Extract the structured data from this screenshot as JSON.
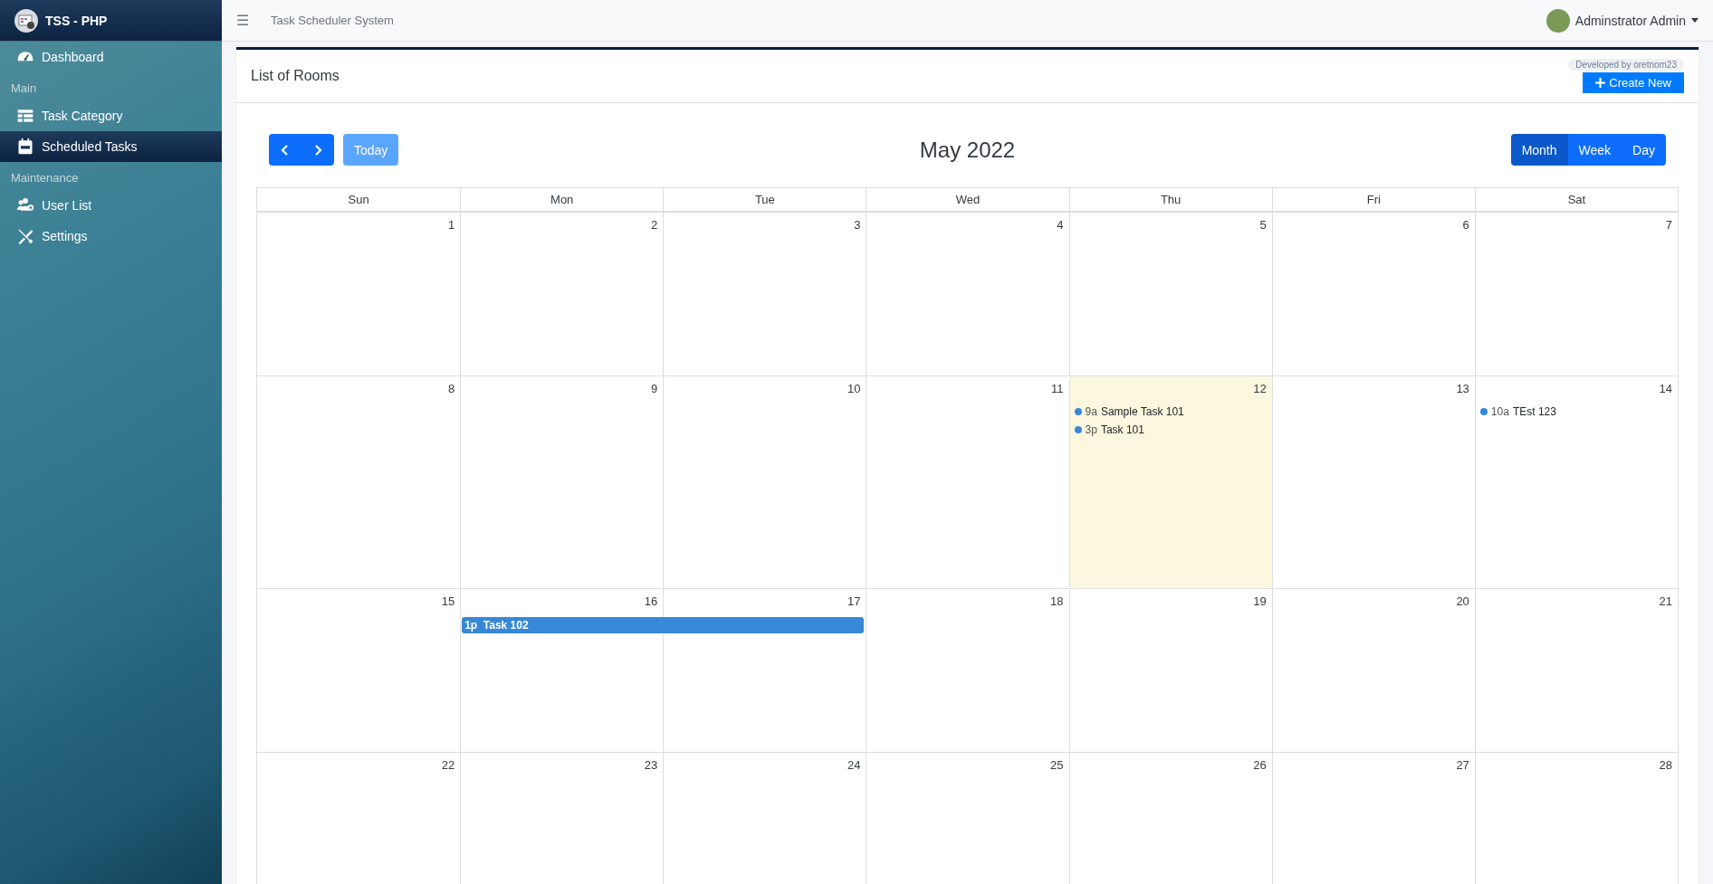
{
  "brand": {
    "title": "TSS - PHP"
  },
  "sidebar": {
    "items": [
      {
        "kind": "link",
        "label": "Dashboard",
        "selected": false
      },
      {
        "kind": "header",
        "label": "Main"
      },
      {
        "kind": "link",
        "label": "Task Category",
        "selected": false
      },
      {
        "kind": "link",
        "label": "Scheduled Tasks",
        "selected": true
      },
      {
        "kind": "header",
        "label": "Maintenance"
      },
      {
        "kind": "link",
        "label": "User List",
        "selected": false
      },
      {
        "kind": "link",
        "label": "Settings",
        "selected": false
      }
    ]
  },
  "topbar": {
    "menu_glyph": "☰",
    "title": "Task Scheduler System",
    "user": "Adminstrator Admin"
  },
  "card": {
    "title": "List of Rooms",
    "credit": "Developed by oretnom23",
    "create_button": "Create New"
  },
  "calendar": {
    "title": "May 2022",
    "today_button": {
      "label": "Today",
      "disabled": true
    },
    "views": [
      {
        "label": "Month",
        "selected": true
      },
      {
        "label": "Week",
        "selected": false
      },
      {
        "label": "Day",
        "selected": false
      }
    ],
    "weekdays": [
      "Sun",
      "Mon",
      "Tue",
      "Wed",
      "Thu",
      "Fri",
      "Sat"
    ],
    "weeks": [
      {
        "days": [
          {
            "date": "1",
            "today": false
          },
          {
            "date": "2",
            "today": false
          },
          {
            "date": "3",
            "today": false
          },
          {
            "date": "4",
            "today": false
          },
          {
            "date": "5",
            "today": false
          },
          {
            "date": "6",
            "today": false
          },
          {
            "date": "7",
            "today": false
          }
        ]
      },
      {
        "days": [
          {
            "date": "8",
            "today": false
          },
          {
            "date": "9",
            "today": false
          },
          {
            "date": "10",
            "today": false
          },
          {
            "date": "11",
            "today": false
          },
          {
            "date": "12",
            "today": true,
            "events": [
              {
                "kind": "dot",
                "time": "9a",
                "title": "Sample Task 101"
              },
              {
                "kind": "dot",
                "time": "3p",
                "title": "Task 101"
              }
            ]
          },
          {
            "date": "13",
            "today": false
          },
          {
            "date": "14",
            "today": false,
            "events": [
              {
                "kind": "dot",
                "time": "10a",
                "title": "TEst 123"
              }
            ]
          }
        ]
      },
      {
        "days": [
          {
            "date": "15",
            "today": false
          },
          {
            "date": "16",
            "today": false,
            "events": [
              {
                "kind": "bar",
                "time": "1p",
                "title": "Task 102"
              }
            ]
          },
          {
            "date": "17",
            "today": false,
            "events": [
              {
                "kind": "continued"
              }
            ]
          },
          {
            "date": "18",
            "today": false
          },
          {
            "date": "19",
            "today": false
          },
          {
            "date": "20",
            "today": false
          },
          {
            "date": "21",
            "today": false
          }
        ]
      },
      {
        "days": [
          {
            "date": "22",
            "today": false
          },
          {
            "date": "23",
            "today": false
          },
          {
            "date": "24",
            "today": false
          },
          {
            "date": "25",
            "today": false
          },
          {
            "date": "26",
            "today": false
          },
          {
            "date": "27",
            "today": false
          },
          {
            "date": "28",
            "today": false
          }
        ]
      }
    ]
  }
}
